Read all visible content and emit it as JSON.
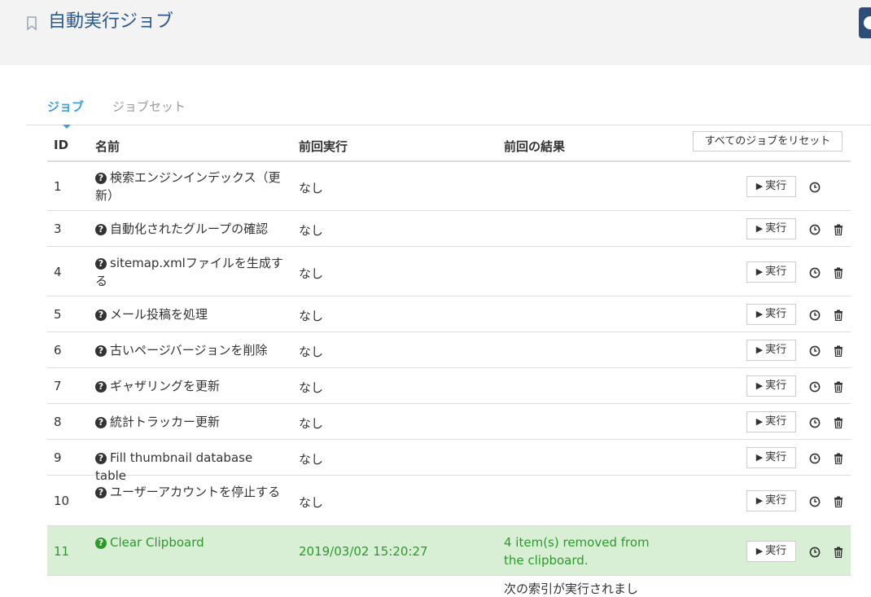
{
  "header": {
    "title": "自動実行ジョブ"
  },
  "tabs": [
    {
      "label": "ジョブ",
      "active": true
    },
    {
      "label": "ジョブセット",
      "active": false
    }
  ],
  "toolbar": {
    "reset_label": "すべてのジョブをリセット"
  },
  "table": {
    "columns": {
      "id": "ID",
      "name": "名前",
      "last_run": "前回実行",
      "result": "前回の結果"
    },
    "run_label": "実行",
    "rows": [
      {
        "id": "1",
        "name": "検索エンジンインデックス（更新）",
        "last_run": "なし",
        "result": "",
        "deletable": false
      },
      {
        "id": "3",
        "name": "自動化されたグループの確認",
        "last_run": "なし",
        "result": "",
        "deletable": true
      },
      {
        "id": "4",
        "name": "sitemap.xmlファイルを生成する",
        "last_run": "なし",
        "result": "",
        "deletable": true
      },
      {
        "id": "5",
        "name": "メール投稿を処理",
        "last_run": "なし",
        "result": "",
        "deletable": true
      },
      {
        "id": "6",
        "name": "古いページバージョンを削除",
        "last_run": "なし",
        "result": "",
        "deletable": true
      },
      {
        "id": "7",
        "name": "ギャザリングを更新",
        "last_run": "なし",
        "result": "",
        "deletable": true
      },
      {
        "id": "8",
        "name": "統計トラッカー更新",
        "last_run": "なし",
        "result": "",
        "deletable": true
      },
      {
        "id": "9",
        "name": "Fill thumbnail database table",
        "last_run": "なし",
        "result": "",
        "deletable": true
      },
      {
        "id": "10",
        "name": "ユーザーアカウントを停止する",
        "last_run": "なし",
        "result": "",
        "deletable": true
      },
      {
        "id": "11",
        "name": "Clear Clipboard",
        "last_run": "2019/03/02 15:20:27",
        "result": "4 item(s) removed from the clipboard.",
        "deletable": true,
        "status": "success"
      }
    ],
    "partial_next_text": "次の索引が実行されまし"
  },
  "colors": {
    "accent": "#3ea0dd",
    "title": "#2a5a8c",
    "success_bg": "#d9efd5",
    "success_text": "#2b9a2b"
  }
}
